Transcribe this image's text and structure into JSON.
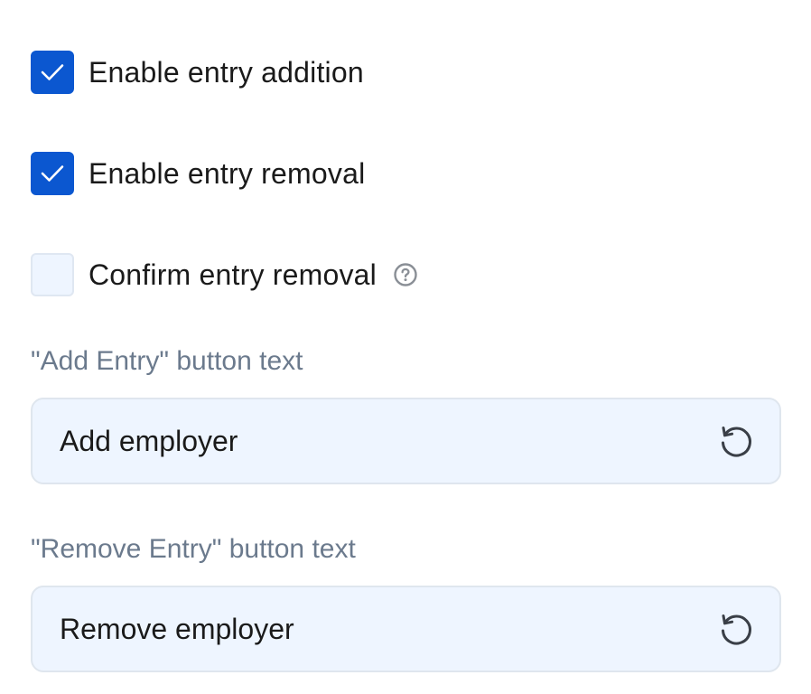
{
  "options": {
    "enable_addition": {
      "label": "Enable entry addition",
      "checked": true
    },
    "enable_removal": {
      "label": "Enable entry removal",
      "checked": true
    },
    "confirm_removal": {
      "label": "Confirm entry removal",
      "checked": false
    }
  },
  "add_entry": {
    "label": "\"Add Entry\" button text",
    "value": "Add employer"
  },
  "remove_entry": {
    "label": "\"Remove Entry\" button text",
    "value": "Remove employer"
  },
  "colors": {
    "accent": "#0b57d0",
    "field_bg": "#eef5ff",
    "label_muted": "#6b7a8d"
  },
  "icons": {
    "check": "checkmark-icon",
    "help": "help-circle-icon",
    "reset": "reset-icon"
  }
}
